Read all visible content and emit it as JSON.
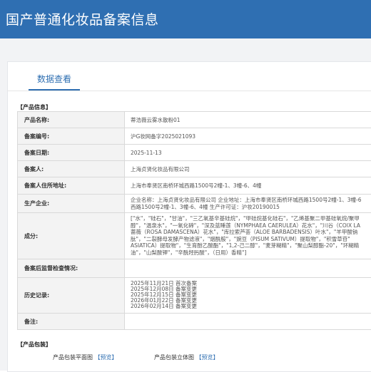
{
  "header": {
    "title": "国产普通化妆品备案信息"
  },
  "tabs": {
    "active": "数据查看"
  },
  "sections": {
    "product_info": "【产品信息】",
    "packaging": "【产品包装】"
  },
  "product": {
    "rows": [
      {
        "label": "产品名称:",
        "value": "蒂浩薇云雾水散粉01"
      },
      {
        "label": "备案编号:",
        "value": "沪G妆网备字2025021093"
      },
      {
        "label": "备案日期:",
        "value": "2025-11-13"
      },
      {
        "label": "备案人:",
        "value": "上海贞贤化妆品有限公司"
      },
      {
        "label": "备案人住所地址:",
        "value": "上海市奉贤区南桥环城西路1500号2幢-1、3幢-6、4幢"
      },
      {
        "label": "生产企业:",
        "lines": [
          "企业名称：上海贞贤化妆品有限公司 企业地址：上海市奉贤区南桥环城西路1500号2幢-1、3幢-6",
          "西路1500号2幢-1、3幢-6、4幢 生产许可证：沪妆20190015"
        ]
      },
      {
        "label": "成分:",
        "lines": [
          "[\"水\"，\"硅石\"，\"甘油\"，\"三乙氧基辛基硅烷\"，\"甲硅烷基化硅石\"，\"乙烯基聚二甲基硅氧烷/聚甲",
          "醇\"，\"温泉水\"，\"一氧化碲\"，\"深及蓝睡莲（NYMPHAEA CAERULEA）花水\"，\"川谷（COIX LA",
          "蔷薇（ROSA DAMASCENA）花水\"，\"库拉索芦荟（ALOE BARBADENSIS）叶水\"，\"羊甲酸钠",
          "肽\"，\"二裂酵母发酵产物滤液\"，\"烟酰胺\"，\"豌豆（PISUM SATIVUM）提取物\"，\"积雪草苷\"",
          "ASIATICA）提取物\"，\"生育酚乙酸酯\"，\"1,2-己二醇\"，\"麦芽糊精\"，\"聚山梨醇酯-20\"，\"环糊精",
          "油\"，\"山梨酸钾\"，\"辛酰羟肟酸\"，（日用）香精\"]"
        ]
      },
      {
        "label": "备案后监督检查情况:",
        "value": ""
      },
      {
        "label": "历史记录:",
        "lines": [
          "2025年11月21日 首次备案",
          "2025年12月08日 备案变更",
          "2025年12月15日 备案变更",
          "2026年01月22日 备案变更",
          "2026年02月14日 备案变更"
        ]
      },
      {
        "label": "备注:",
        "value": ""
      }
    ]
  },
  "packaging": {
    "flat_label": "产品包装平面图",
    "flat_link": "【预览】",
    "solid_label": "产品包装立体图",
    "solid_link": "【预览】"
  },
  "colors": {
    "header_bg": "#2f6fb2",
    "accent": "#2f6fb2",
    "label_bg": "#f3f3f3"
  }
}
